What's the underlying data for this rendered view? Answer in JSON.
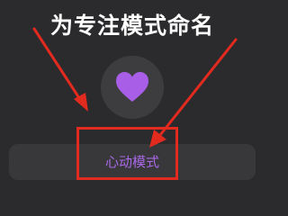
{
  "title": "为专注模式命名",
  "mode_icon": "heart-icon",
  "name_field": {
    "value": "心动模式"
  },
  "colors": {
    "background": "#2b2b2d",
    "icon_bg": "#3d3d40",
    "heart": "#a95ee8",
    "field_bg": "#38383b",
    "field_text": "#a968e6",
    "annotation": "#e22a1f"
  }
}
